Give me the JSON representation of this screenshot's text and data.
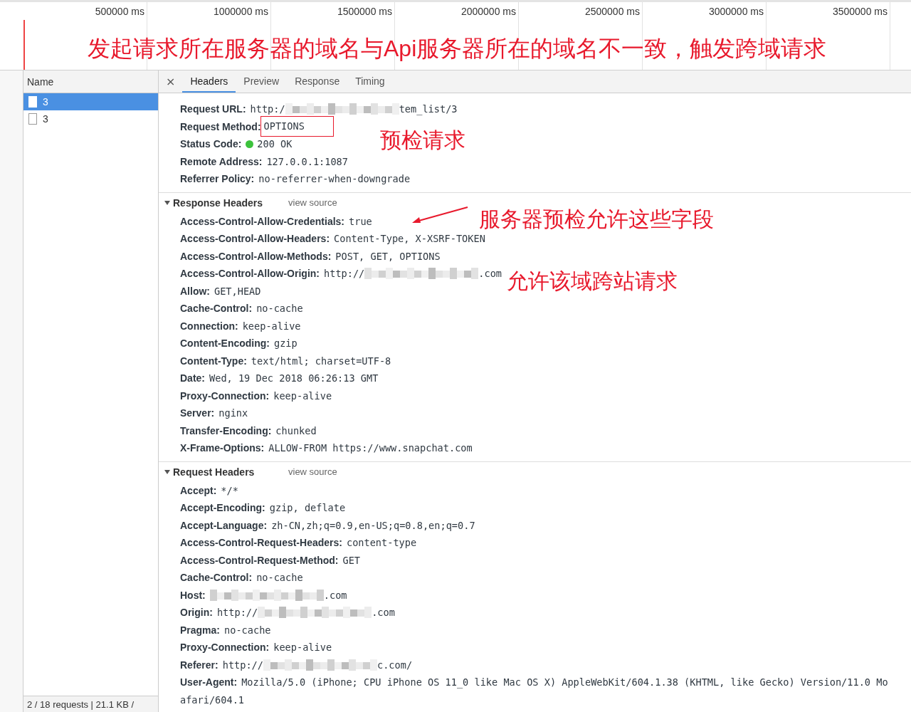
{
  "timeline": {
    "ticks": [
      "500000 ms",
      "1000000 ms",
      "1500000 ms",
      "2000000 ms",
      "2500000 ms",
      "3000000 ms",
      "3500000 ms"
    ],
    "note": "发起请求所在服务器的域名与Api服务器所在的域名不一致，触发跨域请求"
  },
  "requests": {
    "column": "Name",
    "items": [
      {
        "name": "3",
        "selected": true
      },
      {
        "name": "3",
        "selected": false
      }
    ],
    "status": "2 / 18 requests | 21.1 KB /"
  },
  "tabs": [
    {
      "label": "Headers",
      "selected": true
    },
    {
      "label": "Preview",
      "selected": false
    },
    {
      "label": "Response",
      "selected": false
    },
    {
      "label": "Timing",
      "selected": false
    }
  ],
  "close_label": "×",
  "general": {
    "rows": [
      {
        "label": "Request URL:",
        "value": "http:/",
        "masked": true,
        "value_after": "tem_list/3"
      },
      {
        "label": "Request Method:",
        "value": "OPTIONS",
        "boxed": true,
        "note": "预检请求"
      },
      {
        "label": "Status Code:",
        "value": "200 OK",
        "status_dot": true
      },
      {
        "label": "Remote Address:",
        "value": "127.0.0.1:1087"
      },
      {
        "label": "Referrer Policy:",
        "value": "no-referrer-when-downgrade"
      }
    ]
  },
  "response_headers": {
    "title": "Response Headers",
    "expanded": true,
    "view_source": "view source",
    "rows": [
      {
        "label": "Access-Control-Allow-Credentials:",
        "value": "true",
        "note": "服务器预检允许这些字段",
        "arrow": true
      },
      {
        "label": "Access-Control-Allow-Headers:",
        "value": "Content-Type, X-XSRF-TOKEN"
      },
      {
        "label": "Access-Control-Allow-Methods:",
        "value": "POST, GET, OPTIONS"
      },
      {
        "label": "Access-Control-Allow-Origin:",
        "value": "http://",
        "masked": true,
        "value_after": ".com",
        "note": "允许该域跨站请求"
      },
      {
        "label": "Allow:",
        "value": "GET,HEAD"
      },
      {
        "label": "Cache-Control:",
        "value": "no-cache"
      },
      {
        "label": "Connection:",
        "value": "keep-alive"
      },
      {
        "label": "Content-Encoding:",
        "value": "gzip"
      },
      {
        "label": "Content-Type:",
        "value": "text/html; charset=UTF-8"
      },
      {
        "label": "Date:",
        "value": "Wed, 19 Dec 2018 06:26:13 GMT"
      },
      {
        "label": "Proxy-Connection:",
        "value": "keep-alive"
      },
      {
        "label": "Server:",
        "value": "nginx"
      },
      {
        "label": "Transfer-Encoding:",
        "value": "chunked"
      },
      {
        "label": "X-Frame-Options:",
        "value": "ALLOW-FROM https://www.snapchat.com"
      }
    ]
  },
  "request_headers": {
    "title": "Request Headers",
    "expanded": true,
    "view_source": "view source",
    "rows": [
      {
        "label": "Accept:",
        "value": "*/*"
      },
      {
        "label": "Accept-Encoding:",
        "value": "gzip, deflate"
      },
      {
        "label": "Accept-Language:",
        "value": "zh-CN,zh;q=0.9,en-US;q=0.8,en;q=0.7"
      },
      {
        "label": "Access-Control-Request-Headers:",
        "value": "content-type"
      },
      {
        "label": "Access-Control-Request-Method:",
        "value": "GET"
      },
      {
        "label": "Cache-Control:",
        "value": "no-cache"
      },
      {
        "label": "Host:",
        "masked": true,
        "value_after": ".com"
      },
      {
        "label": "Origin:",
        "value": "http://",
        "masked": true,
        "value_after": ".com"
      },
      {
        "label": "Pragma:",
        "value": "no-cache"
      },
      {
        "label": "Proxy-Connection:",
        "value": "keep-alive"
      },
      {
        "label": "Referer:",
        "value": "http://",
        "masked": true,
        "value_after": "c.com/"
      },
      {
        "label": "User-Agent:",
        "value": "Mozilla/5.0 (iPhone; CPU iPhone OS 11_0 like Mac OS X) AppleWebKit/604.1.38 (KHTML, like Gecko) Version/11.0 Mo",
        "wrap": "afari/604.1"
      }
    ]
  }
}
